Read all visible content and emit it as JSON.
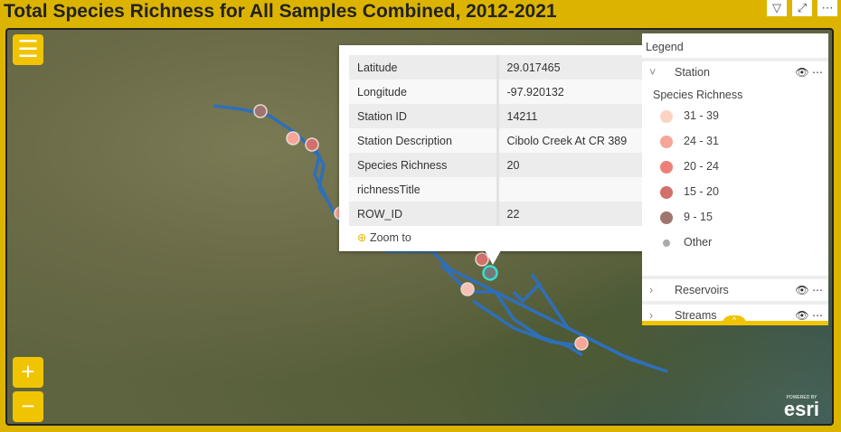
{
  "title": "Total Species Richness for All Samples Combined, 2012-2021",
  "header_icons": [
    "filter-icon",
    "focus-mode-icon",
    "more-options-icon"
  ],
  "map": {
    "zoom_in": "+",
    "zoom_out": "−",
    "menu_icon": "☰",
    "attribution": "esri",
    "attribution_small": "POWERED BY"
  },
  "popup": {
    "rows": [
      {
        "label": "Latitude",
        "value": "29.017465"
      },
      {
        "label": "Longitude",
        "value": "-97.920132"
      },
      {
        "label": "Station ID",
        "value": "14211"
      },
      {
        "label": "Station Description",
        "value": "Cibolo Creek At CR 389"
      },
      {
        "label": "Species Richness",
        "value": "20"
      },
      {
        "label": "richnessTitle",
        "value": ""
      },
      {
        "label": "ROW_ID",
        "value": "22"
      }
    ],
    "zoom_to": "Zoom to"
  },
  "legend": {
    "title": "Legend",
    "layers": [
      "Station",
      "Reservoirs",
      "Streams"
    ],
    "subtitle": "Species Richness",
    "classes": [
      {
        "label": "31 - 39",
        "color": "#fdd3c4"
      },
      {
        "label": "24 - 31",
        "color": "#f7a597"
      },
      {
        "label": "20 - 24",
        "color": "#ee7f78"
      },
      {
        "label": "15 - 20",
        "color": "#d2706c"
      },
      {
        "label": "9 - 15",
        "color": "#a07570"
      },
      {
        "label": "Other",
        "color": "#aaaaaa"
      }
    ]
  }
}
